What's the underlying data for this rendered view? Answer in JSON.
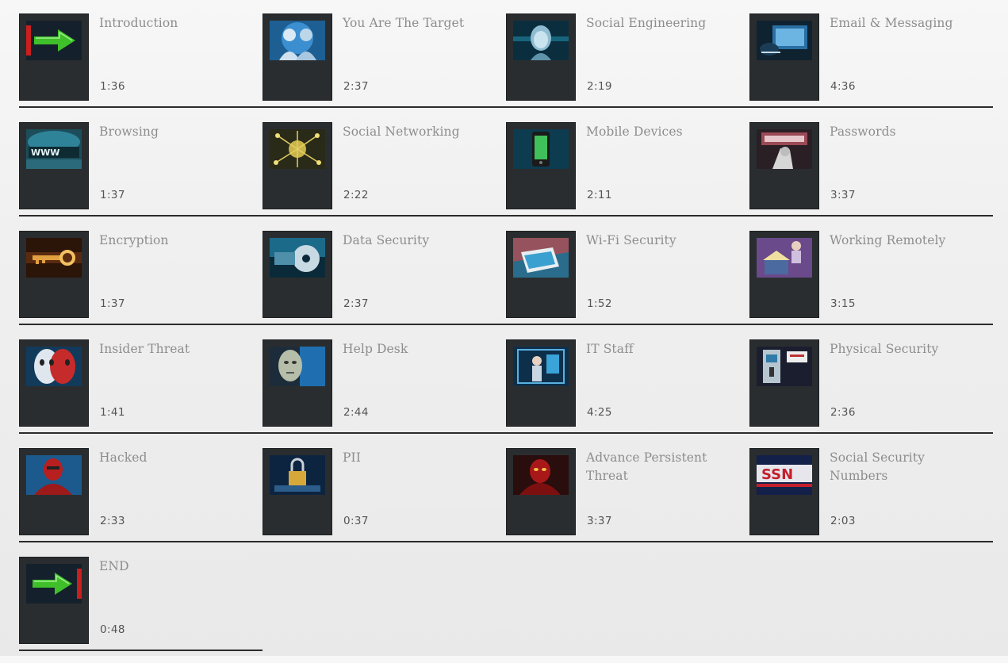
{
  "modules": [
    {
      "title": "Introduction",
      "duration": "1:36",
      "icon": "arrow-right-icon"
    },
    {
      "title": "You Are The Target",
      "duration": "2:37",
      "icon": "target-people-icon"
    },
    {
      "title": "Social Engineering",
      "duration": "2:19",
      "icon": "face-scan-icon"
    },
    {
      "title": "Email & Messaging",
      "duration": "4:36",
      "icon": "email-icon"
    },
    {
      "title": "Browsing",
      "duration": "1:37",
      "icon": "www-icon"
    },
    {
      "title": "Social Networking",
      "duration": "2:22",
      "icon": "network-icon"
    },
    {
      "title": "Mobile Devices",
      "duration": "2:11",
      "icon": "phone-icon"
    },
    {
      "title": "Passwords",
      "duration": "3:37",
      "icon": "password-icon"
    },
    {
      "title": "Encryption",
      "duration": "1:37",
      "icon": "key-icon"
    },
    {
      "title": "Data Security",
      "duration": "2:37",
      "icon": "disc-icon"
    },
    {
      "title": "Wi-Fi Security",
      "duration": "1:52",
      "icon": "laptop-icon"
    },
    {
      "title": "Working Remotely",
      "duration": "3:15",
      "icon": "remote-work-icon"
    },
    {
      "title": "Insider Threat",
      "duration": "1:41",
      "icon": "masks-icon"
    },
    {
      "title": "Help Desk",
      "duration": "2:44",
      "icon": "robot-face-icon"
    },
    {
      "title": "IT Staff",
      "duration": "4:25",
      "icon": "it-staff-icon"
    },
    {
      "title": "Physical Security",
      "duration": "2:36",
      "icon": "door-keypad-icon"
    },
    {
      "title": "Hacked",
      "duration": "2:33",
      "icon": "hacker-icon"
    },
    {
      "title": "PII",
      "duration": "0:37",
      "icon": "padlock-icon"
    },
    {
      "title": "Advance Persistent Threat",
      "duration": "3:37",
      "icon": "red-hacker-icon"
    },
    {
      "title": "Social Security Numbers",
      "duration": "2:03",
      "icon": "ssn-icon"
    },
    {
      "title": "END",
      "duration": "0:48",
      "icon": "arrow-right-icon"
    }
  ]
}
